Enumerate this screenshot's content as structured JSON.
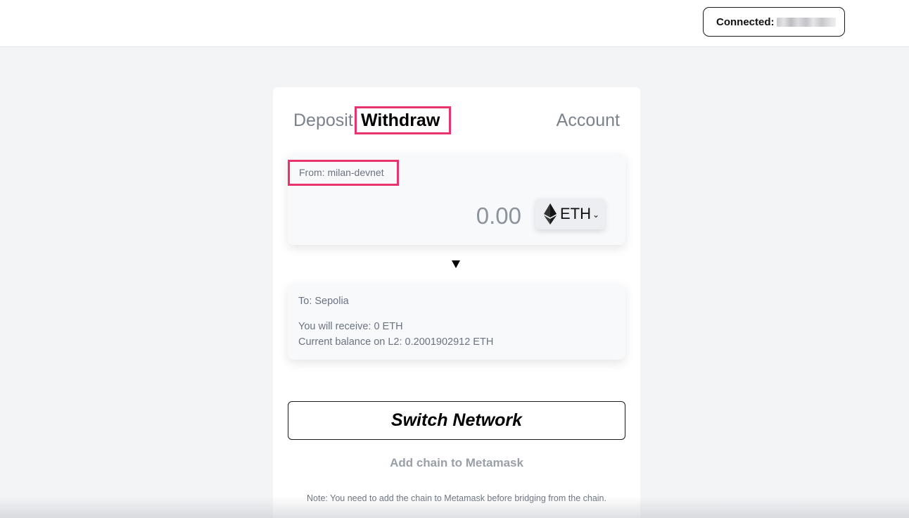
{
  "header": {
    "connected_label": "Connected:",
    "connected_address": ""
  },
  "tabs": {
    "deposit": "Deposit",
    "withdraw": "Withdraw",
    "account": "Account"
  },
  "from": {
    "label": "From: milan-devnet",
    "amount_placeholder": "0.00",
    "token": "ETH",
    "token_icon": "ethereum-icon"
  },
  "to": {
    "label": "To: Sepolia",
    "receive": "You will receive: 0 ETH",
    "balance": "Current balance on L2: 0.2001902912 ETH"
  },
  "actions": {
    "switch_network": "Switch Network",
    "add_chain": "Add chain to Metamask",
    "note": "Note: You need to add the chain to Metamask before bridging from the chain."
  },
  "colors": {
    "highlight": "#e8336d",
    "background": "#f3f4f6",
    "muted_text": "#6b7280"
  }
}
